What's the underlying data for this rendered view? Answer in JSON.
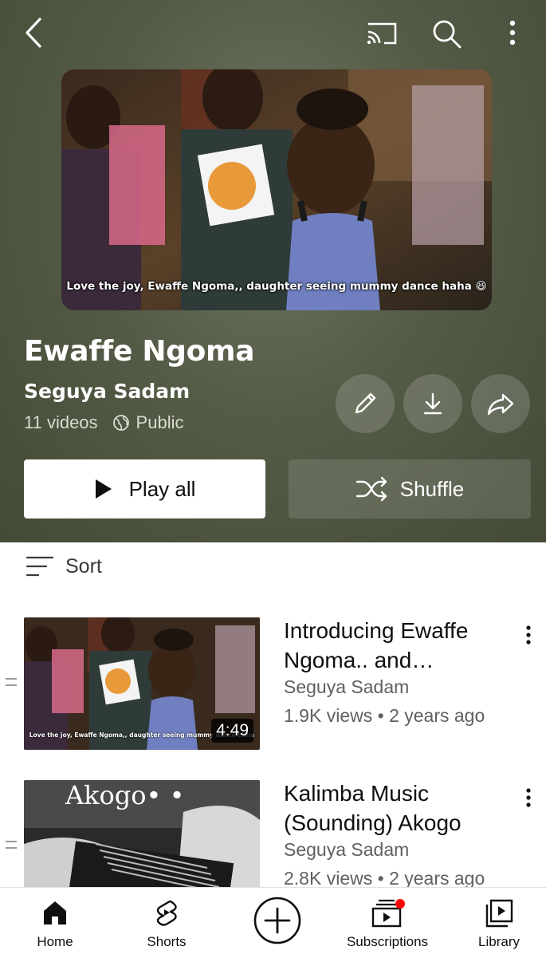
{
  "header": {
    "icons": [
      "back-icon",
      "cast-icon",
      "search-icon",
      "more-vert-icon"
    ]
  },
  "playlist": {
    "cover_caption": "Love the joy, Ewaffe Ngoma,, daughter seeing mummy dance haha 😆",
    "title": "Ewaffe Ngoma",
    "owner": "Seguya Sadam",
    "video_count": "11 videos",
    "visibility": "Public",
    "actions": [
      "edit-icon",
      "download-icon",
      "share-icon"
    ],
    "play_all_label": "Play all",
    "shuffle_label": "Shuffle"
  },
  "sort": {
    "label": "Sort"
  },
  "videos": [
    {
      "title": "Introducing Ewaffe Ngoma.. and…",
      "channel": "Seguya Sadam",
      "views": "1.9K views",
      "age": "2 years ago",
      "duration": "4:49",
      "thumb_caption": "Love the joy, Ewaffe Ngoma,, daughter seeing mummy dance haha"
    },
    {
      "title": "Kalimba Music (Sounding) Akogo",
      "channel": "Seguya Sadam",
      "views": "2.8K views",
      "age": "2 years ago",
      "thumb_text": "Akogo• •"
    }
  ],
  "nav": {
    "home": "Home",
    "shorts": "Shorts",
    "subscriptions": "Subscriptions",
    "library": "Library"
  },
  "colors": {
    "hero_bg": "#545b46",
    "notification_dot": "#ff0000"
  }
}
